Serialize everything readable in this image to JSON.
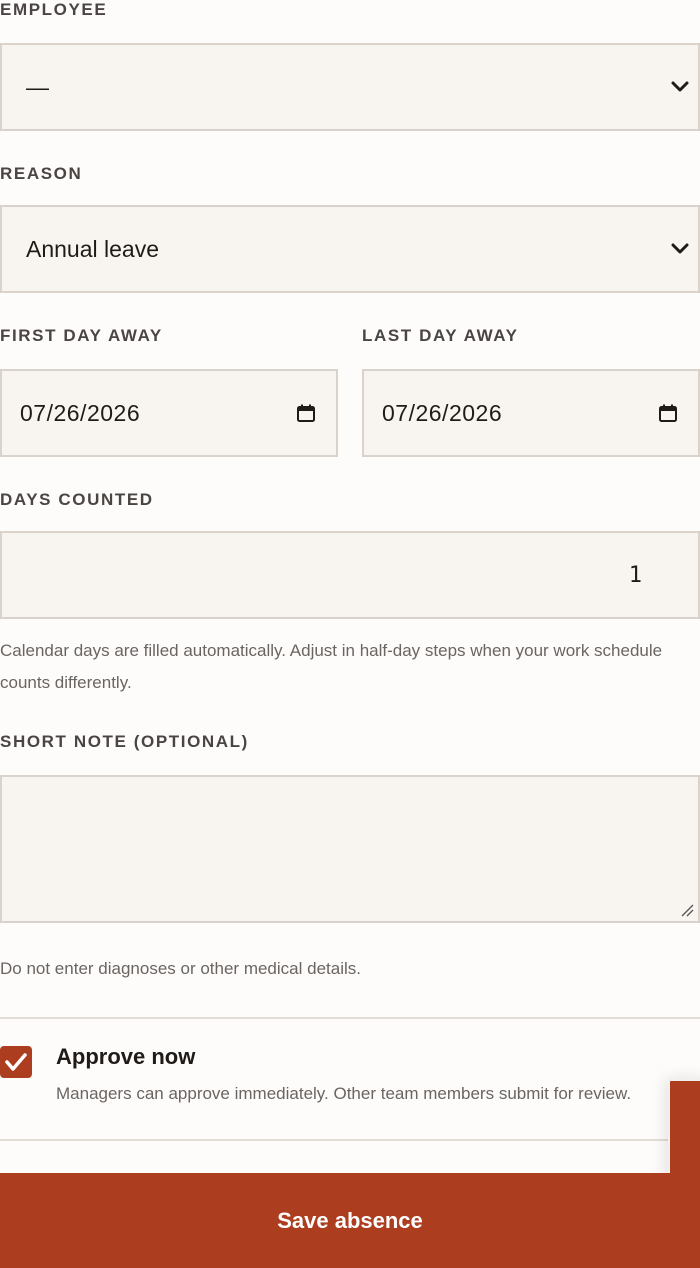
{
  "form": {
    "employee": {
      "label": "EMPLOYEE",
      "selected": "—"
    },
    "reason": {
      "label": "REASON",
      "selected": "Annual leave"
    },
    "first_day": {
      "label": "FIRST DAY AWAY",
      "value": "07/26/2026"
    },
    "last_day": {
      "label": "LAST DAY AWAY",
      "value": "07/26/2026"
    },
    "days_counted": {
      "label": "DAYS COUNTED",
      "value": "1",
      "help": "Calendar days are filled automatically. Adjust in half-day steps when your work schedule counts differently."
    },
    "note": {
      "label": "SHORT NOTE (OPTIONAL)",
      "value": "",
      "help": "Do not enter diagnoses or other medical details."
    },
    "approve": {
      "title": "Approve now",
      "description": "Managers can approve immediately. Other team members submit for review.",
      "checked": true
    },
    "save_label": "Save absence"
  },
  "colors": {
    "accent": "#ac3d1f",
    "field_bg": "#f8f5f0",
    "field_border": "#d9d3cb",
    "page_bg": "#fefcfb"
  },
  "icons": {
    "select_chevron": "chevron-down-icon",
    "date_picker": "calendar-icon",
    "checkbox_mark": "check-icon"
  }
}
